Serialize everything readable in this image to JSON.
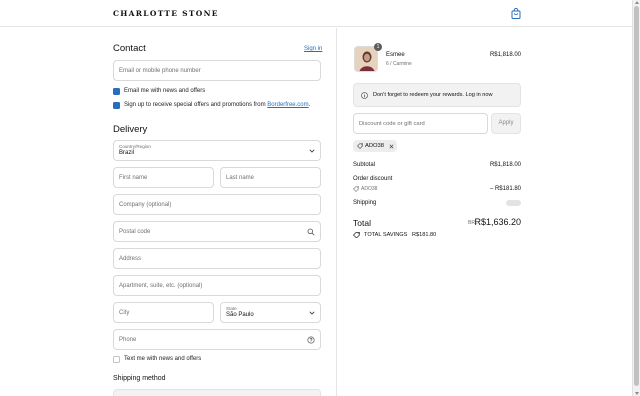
{
  "header": {
    "brand": "CHARLOTTE STONE",
    "cart_icon": "shopping-bag-icon"
  },
  "contact": {
    "heading": "Contact",
    "signin_label": "Sign in",
    "email_placeholder": "Email or mobile phone number",
    "news_label": "Email me with news and offers",
    "news_checked": true,
    "promo_label_prefix": "Sign up to receive special offers and promotions from ",
    "promo_link": "Borderfree.com",
    "promo_label_suffix": ".",
    "promo_checked": true
  },
  "delivery": {
    "heading": "Delivery",
    "country_label": "Country/Region",
    "country_value": "Brazil",
    "first_name_placeholder": "First name",
    "last_name_placeholder": "Last name",
    "company_placeholder": "Company (optional)",
    "postal_placeholder": "Postal code",
    "address_placeholder": "Address",
    "apartment_placeholder": "Apartment, suite, etc. (optional)",
    "city_placeholder": "City",
    "state_label": "State",
    "state_value": "São Paulo",
    "phone_placeholder": "Phone",
    "text_label": "Text me with news and offers",
    "text_checked": false
  },
  "shipping_method": {
    "heading": "Shipping method"
  },
  "summary": {
    "item": {
      "name": "Esmee",
      "variant": "6 / Carmine",
      "price": "R$1,818.00",
      "quantity": "1"
    },
    "rewards_notice": "Don't forget to redeem your rewards. Log in now",
    "discount_placeholder": "Discount code or gift card",
    "apply_label": "Apply",
    "applied_code": "ADO38",
    "subtotal_label": "Subtotal",
    "subtotal_value": "R$1,818.00",
    "order_discount_label": "Order discount",
    "discount_code": "ADO38",
    "discount_value": "– R$181.80",
    "shipping_label": "Shipping",
    "total_label": "Total",
    "currency": "BRL",
    "total_value": "R$1,636.20",
    "savings_label": "TOTAL SAVINGS",
    "savings_value": "R$181.80"
  },
  "colors": {
    "accent": "#2a6ebb",
    "border": "#d9d9d9"
  }
}
